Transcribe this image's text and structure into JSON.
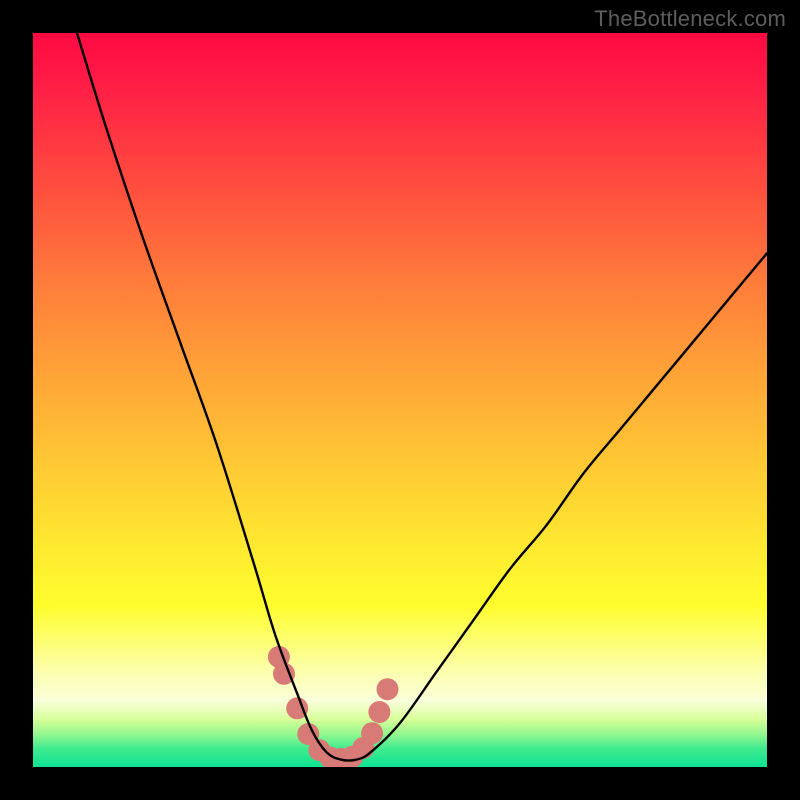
{
  "watermark": "TheBottleneck.com",
  "colors": {
    "frame": "#000000",
    "curve": "#000000",
    "marker": "#d87a76",
    "gradient_top": "#ff0a43",
    "gradient_bottom": "#0ce392"
  },
  "chart_data": {
    "type": "line",
    "title": "",
    "xlabel": "",
    "ylabel": "",
    "xlim": [
      0,
      100
    ],
    "ylim": [
      0,
      100
    ],
    "note": "Values estimated from pixel positions; y = bottleneck percentage (0 at bottom, 100 at top).",
    "series": [
      {
        "name": "bottleneck-curve",
        "x": [
          6,
          10,
          15,
          20,
          25,
          30,
          33,
          36,
          38,
          40,
          42,
          44,
          46,
          50,
          55,
          60,
          65,
          70,
          75,
          80,
          85,
          90,
          95,
          100
        ],
        "y": [
          100,
          87,
          72,
          58,
          44,
          28,
          18,
          10,
          5,
          2,
          1,
          1,
          2,
          6,
          13,
          20,
          27,
          33,
          40,
          46,
          52,
          58,
          64,
          70
        ]
      }
    ],
    "markers": {
      "name": "highlight-points",
      "x": [
        33.5,
        34.2,
        36.0,
        37.5,
        39.0,
        40.5,
        42.0,
        43.5,
        45.0,
        46.2,
        47.2,
        48.3
      ],
      "y": [
        15.0,
        12.7,
        8.0,
        4.5,
        2.3,
        1.3,
        1.1,
        1.4,
        2.6,
        4.6,
        7.5,
        10.6
      ]
    }
  }
}
